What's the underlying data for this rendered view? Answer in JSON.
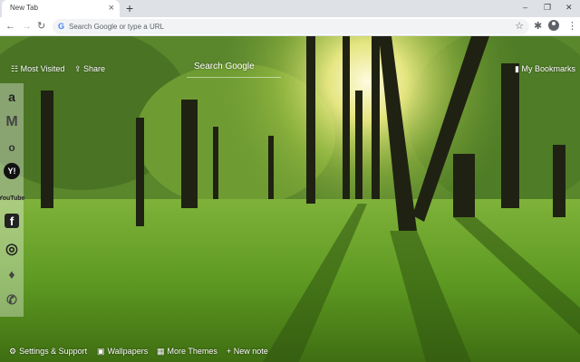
{
  "browser": {
    "tab_title": "New Tab",
    "tab_close": "×",
    "new_tab": "+",
    "window_controls": [
      "–",
      "❐",
      "✕"
    ],
    "nav": {
      "back": "←",
      "forward": "→",
      "reload": "↻"
    },
    "omnibox_g": "G",
    "omnibox_placeholder": "Search Google or type a URL",
    "star": "☆",
    "extensions": "✱",
    "menu": "⋮"
  },
  "page": {
    "most_visited": "Most Visited",
    "share": "Share",
    "search_placeholder": "Search Google",
    "bookmarks": "My Bookmarks"
  },
  "sidebar": {
    "items": [
      {
        "icon": "amazon-icon",
        "glyph": "a"
      },
      {
        "icon": "gmail-icon",
        "glyph": "M"
      },
      {
        "icon": "outlook-icon",
        "glyph": "o"
      },
      {
        "icon": "yahoo-icon",
        "glyph": "Y!"
      },
      {
        "icon": "youtube-icon",
        "glyph": "YouTube"
      },
      {
        "icon": "facebook-icon",
        "glyph": "f"
      },
      {
        "icon": "instagram-icon",
        "glyph": "◎"
      },
      {
        "icon": "twitter-icon",
        "glyph": "♦"
      },
      {
        "icon": "whatsapp-icon",
        "glyph": "✆"
      }
    ]
  },
  "footer": {
    "settings": "Settings & Support",
    "wallpapers": "Wallpapers",
    "more_themes": "More Themes",
    "new_note": "+ New note"
  },
  "colors": {
    "accent": "#4285f4",
    "chrome": "#dee1e6"
  }
}
